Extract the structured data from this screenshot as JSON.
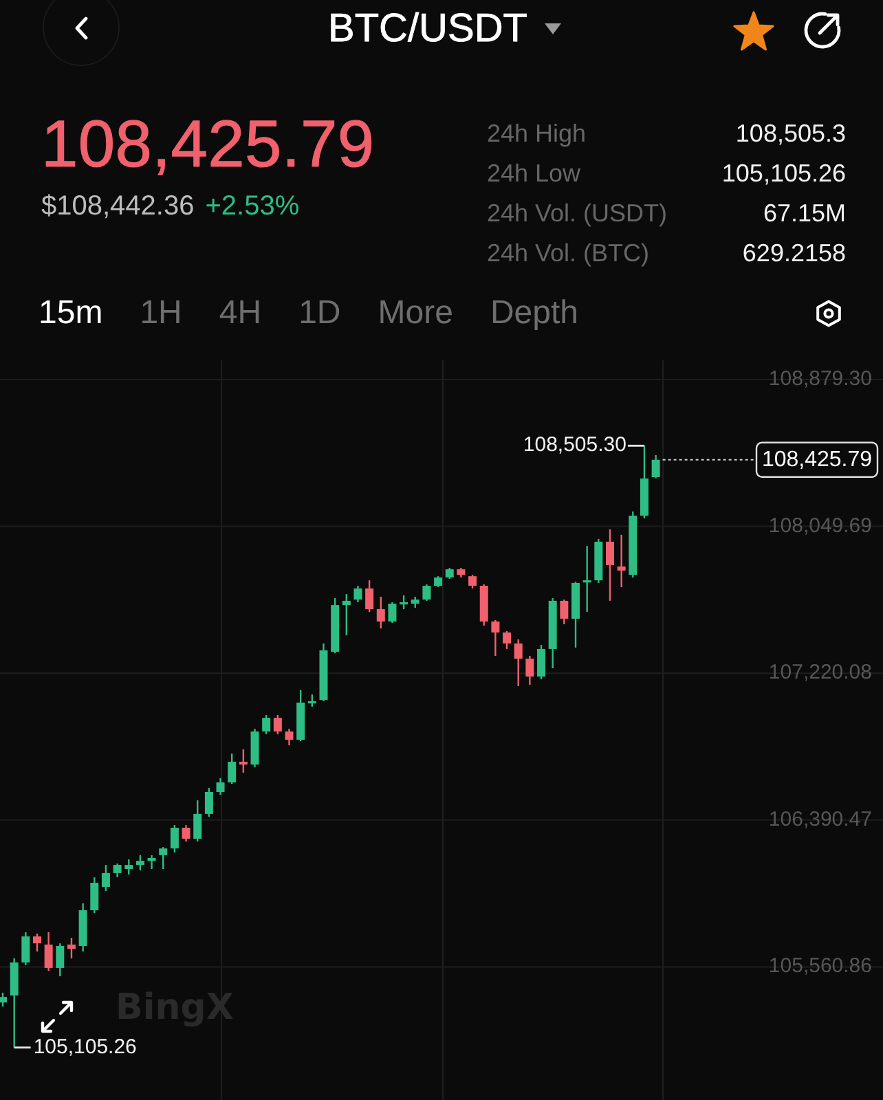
{
  "header": {
    "title": "BTC/USDT",
    "favorite": true
  },
  "ticker": {
    "last_price": "108,425.79",
    "last_price_up": false,
    "usd_value": "$108,442.36",
    "change": "+2.53%",
    "change_up": true
  },
  "stats": [
    {
      "label": "24h High",
      "value": "108,505.3"
    },
    {
      "label": "24h Low",
      "value": "105,105.26"
    },
    {
      "label": "24h Vol. (USDT)",
      "value": "67.15M"
    },
    {
      "label": "24h Vol. (BTC)",
      "value": "629.2158"
    }
  ],
  "timeframes": [
    {
      "label": "15m",
      "selected": true
    },
    {
      "label": "1H",
      "selected": false
    },
    {
      "label": "4H",
      "selected": false
    },
    {
      "label": "1D",
      "selected": false
    },
    {
      "label": "More",
      "selected": false
    },
    {
      "label": "Depth",
      "selected": false
    }
  ],
  "chart": {
    "chart_data": {
      "type": "candlestick",
      "grid": true,
      "categories": [
        null,
        null,
        null,
        null,
        null,
        null,
        null,
        null,
        null,
        null,
        null,
        null,
        null,
        null,
        null,
        null,
        null,
        null,
        null,
        null,
        null,
        null,
        null,
        null,
        null,
        null,
        null,
        null,
        null,
        null,
        null,
        null,
        null,
        null,
        null,
        null,
        null,
        null,
        null,
        null,
        null,
        null,
        null,
        null,
        null,
        null,
        null,
        null,
        null,
        null,
        null,
        null,
        null,
        null,
        null,
        null,
        null,
        null
      ],
      "ohlc": [
        [
          105360,
          105415,
          105337,
          105391
        ],
        [
          105399,
          105609,
          105105.26,
          105586
        ],
        [
          105586,
          105757,
          105570,
          105733
        ],
        [
          105733,
          105749,
          105648,
          105694
        ],
        [
          105687,
          105757,
          105539,
          105555
        ],
        [
          105555,
          105694,
          105508,
          105679
        ],
        [
          105687,
          105725,
          105609,
          105663
        ],
        [
          105679,
          105920,
          105648,
          105881
        ],
        [
          105881,
          106067,
          105865,
          106036
        ],
        [
          106013,
          106137,
          105990,
          106091
        ],
        [
          106091,
          106145,
          106067,
          106137
        ],
        [
          106114,
          106168,
          106083,
          106137
        ],
        [
          106137,
          106192,
          106106,
          106160
        ],
        [
          106160,
          106192,
          106114,
          106176
        ],
        [
          106192,
          106238,
          106114,
          106230
        ],
        [
          106230,
          106362,
          106207,
          106347
        ],
        [
          106347,
          106362,
          106269,
          106285
        ],
        [
          106285,
          106502,
          106269,
          106425
        ],
        [
          106425,
          106572,
          106409,
          106549
        ],
        [
          106549,
          106627,
          106533,
          106603
        ],
        [
          106603,
          106766,
          106595,
          106720
        ],
        [
          106720,
          106790,
          106658,
          106704
        ],
        [
          106704,
          106906,
          106689,
          106891
        ],
        [
          106891,
          106984,
          106875,
          106968
        ],
        [
          106968,
          106984,
          106875,
          106891
        ],
        [
          106891,
          106906,
          106813,
          106844
        ],
        [
          106844,
          107124,
          106836,
          107054
        ],
        [
          107054,
          107100,
          107031,
          107062
        ],
        [
          107069,
          107388,
          107062,
          107349
        ],
        [
          107341,
          107644,
          107333,
          107605
        ],
        [
          107605,
          107667,
          107434,
          107629
        ],
        [
          107636,
          107714,
          107621,
          107699
        ],
        [
          107699,
          107745,
          107566,
          107582
        ],
        [
          107582,
          107652,
          107473,
          107512
        ],
        [
          107512,
          107621,
          107504,
          107613
        ],
        [
          107613,
          107660,
          107582,
          107621
        ],
        [
          107613,
          107652,
          107590,
          107636
        ],
        [
          107636,
          107722,
          107629,
          107714
        ],
        [
          107714,
          107768,
          107706,
          107761
        ],
        [
          107761,
          107815,
          107753,
          107807
        ],
        [
          107807,
          107815,
          107761,
          107776
        ],
        [
          107768,
          107776,
          107699,
          107714
        ],
        [
          107714,
          107722,
          107489,
          107512
        ],
        [
          107512,
          107520,
          107318,
          107450
        ],
        [
          107450,
          107458,
          107357,
          107388
        ],
        [
          107388,
          107411,
          107147,
          107302
        ],
        [
          107302,
          107318,
          107155,
          107201
        ],
        [
          107201,
          107380,
          107186,
          107357
        ],
        [
          107357,
          107644,
          107248,
          107629
        ],
        [
          107629,
          107636,
          107497,
          107528
        ],
        [
          107528,
          107737,
          107365,
          107730
        ],
        [
          107737,
          107939,
          107566,
          107745
        ],
        [
          107745,
          107978,
          107730,
          107963
        ],
        [
          107963,
          108033,
          107629,
          107831
        ],
        [
          107823,
          108002,
          107706,
          107800
        ],
        [
          107776,
          108134,
          107761,
          108110
        ],
        [
          108110,
          108505.3,
          108095,
          108320
        ],
        [
          108328,
          108452,
          108320,
          108425.79
        ]
      ],
      "ylim": [
        104808.9,
        108988.1
      ],
      "yticks": [
        {
          "value": 108879.3,
          "label": "108,879.30"
        },
        {
          "value": 108049.69,
          "label": "108,049.69"
        },
        {
          "value": 107220.08,
          "label": "107,220.08"
        },
        {
          "value": 106390.47,
          "label": "106,390.47"
        },
        {
          "value": 105560.86,
          "label": "105,560.86"
        }
      ]
    },
    "high_label": "108,505.30",
    "low_label": "105,105.26",
    "current_price_tag": "108,425.79",
    "watermark": "BingX"
  }
}
